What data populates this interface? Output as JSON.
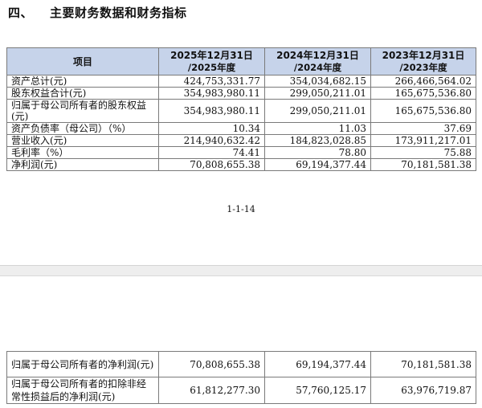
{
  "section": {
    "number": "四、",
    "title": "主要财务数据和财务指标"
  },
  "table1": {
    "header": {
      "item": "项目",
      "col1_line1": "2025年12月31日",
      "col1_line2": "/2025年度",
      "col2_line1": "2024年12月31日",
      "col2_line2": "/2024年度",
      "col3_line1": "2023年12月31日",
      "col3_line2": "/2023年度"
    },
    "rows": [
      {
        "label": "资产总计(元)",
        "v1": "424,753,331.77",
        "v2": "354,034,682.15",
        "v3": "266,466,564.02"
      },
      {
        "label": "股东权益合计(元)",
        "v1": "354,983,980.11",
        "v2": "299,050,211.01",
        "v3": "165,675,536.80"
      },
      {
        "label": "归属于母公司所有者的股东权益(元)",
        "v1": "354,983,980.11",
        "v2": "299,050,211.01",
        "v3": "165,675,536.80"
      },
      {
        "label": "资产负债率（母公司）（%）",
        "v1": "10.34",
        "v2": "11.03",
        "v3": "37.69"
      },
      {
        "label": "营业收入(元)",
        "v1": "214,940,632.42",
        "v2": "184,823,028.85",
        "v3": "173,911,217.01"
      },
      {
        "label": "毛利率（%）",
        "v1": "74.41",
        "v2": "78.80",
        "v3": "75.88"
      },
      {
        "label": "净利润(元)",
        "v1": "70,808,655.38",
        "v2": "69,194,377.44",
        "v3": "70,181,581.38"
      }
    ]
  },
  "page_number": "1-1-14",
  "table2": {
    "rows": [
      {
        "label": "归属于母公司所有者的净利润(元)",
        "v1": "70,808,655.38",
        "v2": "69,194,377.44",
        "v3": "70,181,581.38"
      },
      {
        "label": "归属于母公司所有者的扣除非经常性损益后的净利润(元)",
        "v1": "61,812,277.30",
        "v2": "57,760,125.17",
        "v3": "63,976,719.87"
      }
    ]
  }
}
